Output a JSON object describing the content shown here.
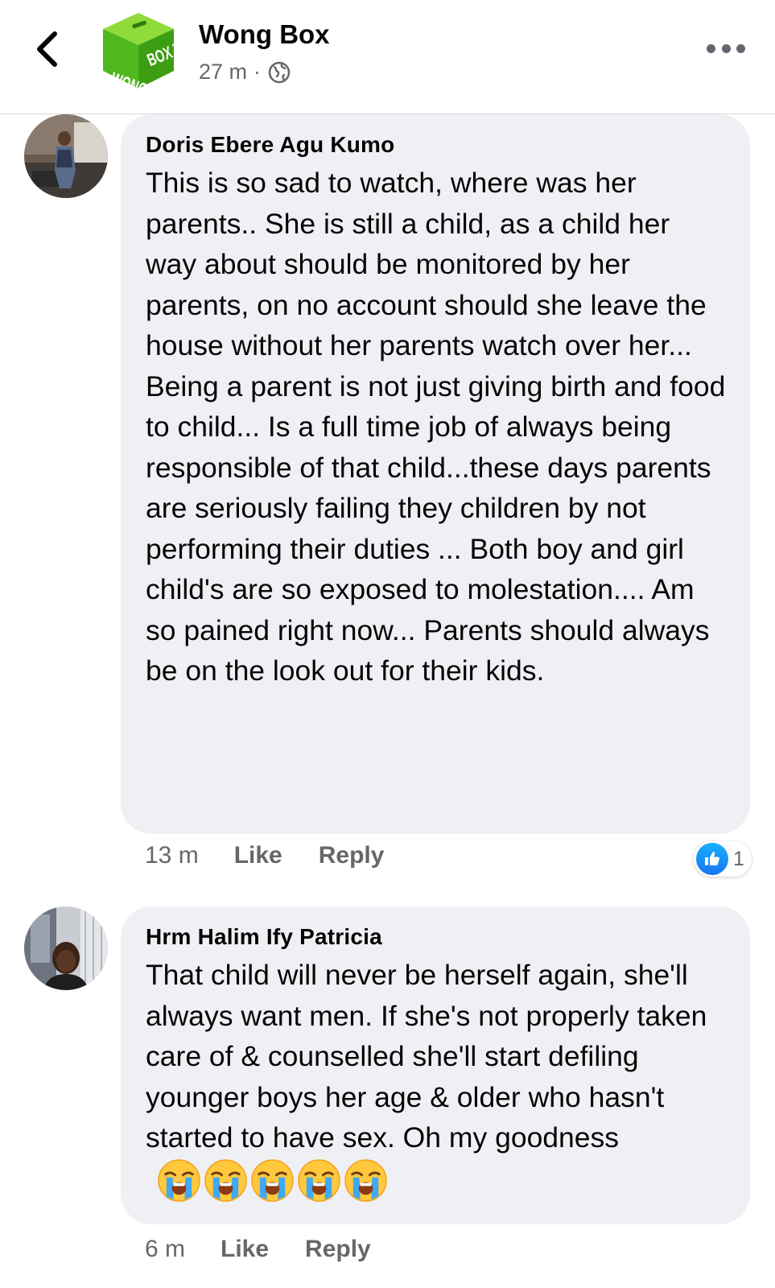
{
  "header": {
    "page_name": "Wong Box",
    "post_time": "27 m",
    "separator": "·",
    "avatar_logo_text": "WONG BOX TV",
    "privacy_icon": "globe-icon",
    "back_icon": "chevron-left-icon",
    "more_icon": "more-horizontal-icon"
  },
  "comments": [
    {
      "author": "Doris Ebere Agu Kumo",
      "text": "This is so sad to watch, where was her parents.. She is still a child, as a child her way about should be monitored by her parents, on no account should she leave the house without her parents watch over her... Being a parent is not just giving birth and food to child... Is a full time job of always being responsible of that child...these days parents are seriously failing they children by not performing their duties ... Both boy and girl child's are so exposed to molestation.... Am so pained right now... Parents should always be on the look out for their kids.",
      "time": "13 m",
      "like_label": "Like",
      "reply_label": "Reply",
      "reaction_icon": "like-icon",
      "reaction_count": "1"
    },
    {
      "author": "Hrm Halim Ify Patricia",
      "text": "That child will never be herself again, she'll always want men. If she's not properly taken care of & counselled she'll start defiling younger boys her age & older who hasn't started to have sex. Oh my goodness",
      "emoji_icon": "loudly-crying-face-icon",
      "emoji_count": 5,
      "time": "6 m",
      "like_label": "Like",
      "reply_label": "Reply"
    }
  ],
  "colors": {
    "bubble": "#eff0f4",
    "secondary_text": "#65676b",
    "like_blue": "#1877f2",
    "logo_green": "#5cc022"
  }
}
